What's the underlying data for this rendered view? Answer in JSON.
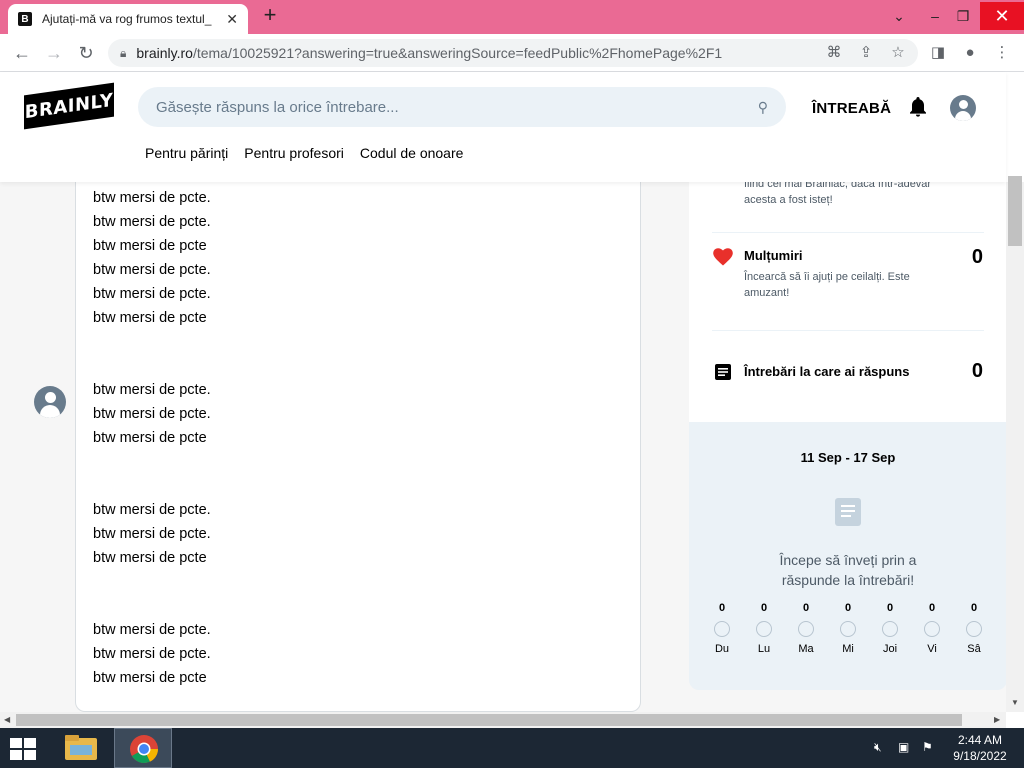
{
  "browser": {
    "tab_title": "Ajutați-mă va rog frumos textul_",
    "tab_close": "✕",
    "new_tab": "+",
    "url_host": "brainly.ro",
    "url_path": "/tema/10025921?answering=true&answeringSource=feedPublic%2FhomePage%2F1"
  },
  "site": {
    "logo": "BRAINLY",
    "search_placeholder": "Găsește răspuns la orice întrebare...",
    "ask_label": "ÎNTREABĂ",
    "nav": [
      "Pentru părinți",
      "Pentru profesori",
      "Codul de onoare"
    ]
  },
  "answer_lines": [
    "btw mersi de pcte.",
    "btw mersi de pcte.",
    "btw mersi de pcte",
    "btw mersi de pcte.",
    "btw mersi de pcte.",
    "btw mersi de pcte",
    "btw mersi de pcte.",
    "btw mersi de pcte.",
    "btw mersi de pcte",
    "btw mersi de pcte.",
    "btw mersi de pcte.",
    "btw mersi de pcte",
    "btw mersi de pcte.",
    "btw mersi de pcte.",
    "btw mersi de pcte"
  ],
  "side_panel": {
    "partial_text": "fiind cel mai Brainiac, dacă într-adevăr acesta a fost isteț!",
    "thanks_title": "Mulțumiri",
    "thanks_desc": "Încearcă să îi ajuți pe ceilalți. Este amuzant!",
    "thanks_count": "0",
    "answers_title": "Întrebări la care ai răspuns",
    "answers_count": "0"
  },
  "weekly": {
    "range": "11 Sep - 17 Sep",
    "message_line1": "Începe să înveți prin a",
    "message_line2": "răspunde la întrebări!",
    "days": [
      {
        "count": "0",
        "label": "Du"
      },
      {
        "count": "0",
        "label": "Lu"
      },
      {
        "count": "0",
        "label": "Ma"
      },
      {
        "count": "0",
        "label": "Mi"
      },
      {
        "count": "0",
        "label": "Joi"
      },
      {
        "count": "0",
        "label": "Vi"
      },
      {
        "count": "0",
        "label": "Sâ"
      }
    ]
  },
  "taskbar": {
    "time": "2:44 AM",
    "date": "9/18/2022"
  },
  "colors": {
    "titlebar": "#ea6a94",
    "heart": "#e8302b",
    "taskbar": "#1c2734"
  }
}
